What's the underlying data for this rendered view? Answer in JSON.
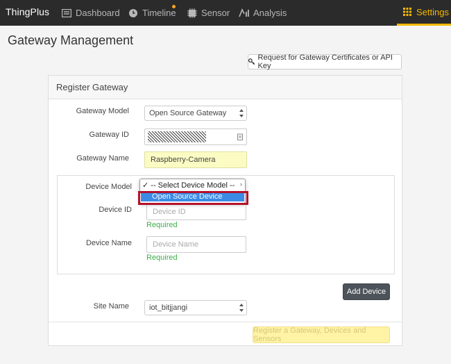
{
  "nav": {
    "brand": "ThingPlus",
    "items": [
      {
        "label": "Dashboard",
        "icon": "dashboard-icon"
      },
      {
        "label": "Timeline",
        "icon": "clock-icon"
      },
      {
        "label": "Sensor",
        "icon": "sensor-icon"
      },
      {
        "label": "Analysis",
        "icon": "analysis-icon"
      }
    ],
    "settings_label": "Settings",
    "accent_color": "#f5b800"
  },
  "page": {
    "title": "Gateway Management",
    "cert_button": "Request for Gateway Certificates or API Key"
  },
  "form": {
    "panel_title": "Register Gateway",
    "gateway_model_label": "Gateway Model",
    "gateway_model_value": "Open Source Gateway",
    "gateway_id_label": "Gateway ID",
    "gateway_name_label": "Gateway Name",
    "gateway_name_value": "Raspberry-Camera",
    "device": {
      "model_label": "Device Model",
      "model_selected": "-- Select Device Model --",
      "model_options": [
        "-- Select Device Model --",
        "Open Source Device"
      ],
      "id_label": "Device ID",
      "id_placeholder": "Device ID",
      "name_label": "Device Name",
      "name_placeholder": "Device Name",
      "required_text": "Required"
    },
    "add_device_button": "Add Device",
    "site_name_label": "Site Name",
    "site_name_value": "iot_bitjjangi",
    "register_button": "Register a Gateway, Devices and Sensors"
  }
}
